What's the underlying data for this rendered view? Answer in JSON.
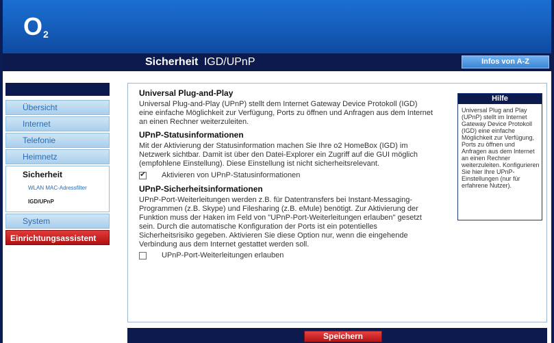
{
  "header": {
    "logo": "O",
    "logo_sub": "2"
  },
  "titlebar": {
    "section": "Sicherheit",
    "subsection": "IGD/UPnP",
    "info_button": "Infos von A-Z"
  },
  "sidebar": {
    "items": [
      {
        "label": "Übersicht"
      },
      {
        "label": "Internet"
      },
      {
        "label": "Telefonie"
      },
      {
        "label": "Heimnetz"
      }
    ],
    "active": {
      "label": "Sicherheit",
      "subitems": [
        {
          "label": "WLAN MAC-Adressfilter"
        },
        {
          "label": "IGD/UPnP"
        }
      ]
    },
    "after": [
      {
        "label": "System"
      }
    ],
    "wizard": "Einrichtungsassistent"
  },
  "content": {
    "upnp": {
      "title": "Universal Plug-and-Play",
      "text": "Universal Plug-and-Play (UPnP) stellt dem Internet Gateway Device Protokoll (IGD) eine einfache Möglichkeit zur Verfügung, Ports zu öffnen und Anfragen aus dem Internet an einen Rechner weiterzuleiten."
    },
    "status": {
      "title": "UPnP-Statusinformationen",
      "text": "Mit der Aktivierung der Statusinformation machen Sie Ihre o2 HomeBox (IGD) im Netzwerk sichtbar. Damit ist über den Datei-Explorer ein Zugriff auf die GUI möglich (empfohlene Einstellung). Diese Einstellung ist nicht sicherheitsrelevant.",
      "checkbox_label": "Aktivieren von UPnP-Statusinformationen",
      "checked": true
    },
    "security": {
      "title": "UPnP-Sicherheitsinformationen",
      "text": "UPnP-Port-Weiterleitungen werden z.B. für Datentransfers bei Instant-Messaging-Programmen (z.B. Skype) und Filesharing (z.B. eMule) benötigt. Zur Aktivierung der Funktion muss der Haken im Feld von \"UPnP-Port-Weiterleitungen erlauben\" gesetzt sein. Durch die automatische Konfiguration der Ports ist ein potentielles Sicherheitsrisiko gegeben. Aktivieren Sie diese Option nur, wenn die eingehende Verbindung aus dem Internet gestattet werden soll.",
      "checkbox_label": "UPnP-Port-Weiterleitungen erlauben",
      "checked": false
    }
  },
  "help": {
    "title": "Hilfe",
    "text": "Universal Plug and Play (UPnP) stellt im Internet Gateway Device Protokoll (IGD) eine einfache Möglichkeit zur Verfügung, Ports zu öffnen und Anfragen aus dem Internet an einen Rechner weiterzuleiten. Konfigurieren Sie hier Ihre UPnP-Einstellungen (nur für erfahrene Nutzer)."
  },
  "footer": {
    "save_button": "Speichern"
  },
  "colors": {
    "brand_blue": "#1660be",
    "navy": "#0c1a4d",
    "accent_red": "#c81e1e",
    "nav_light": "#b8d8ef"
  }
}
